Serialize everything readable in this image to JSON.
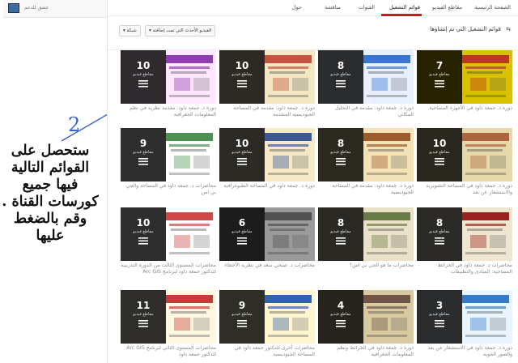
{
  "left": {
    "channel_name": "عشق للدعم",
    "annotation": "ستحصل على القوائم التالية فيها جميع كورسات القناة . وقم بالضغط عليها",
    "annotation_mark": "2"
  },
  "tabs": [
    {
      "label": "الصفحة الرئيسية",
      "active": false
    },
    {
      "label": "مقاطع الفيديو",
      "active": false
    },
    {
      "label": "قوائم التشغيل",
      "active": true
    },
    {
      "label": "القنوات",
      "active": false
    },
    {
      "label": "مناقشة",
      "active": false
    },
    {
      "label": "حول",
      "active": false
    }
  ],
  "section": {
    "title": "قوائم التشغيل التي تم إنشاؤها",
    "sort_label": "الفيديو الأحدث التي تمت إضافته",
    "share_label": "شبكة"
  },
  "overlay_label": "مقاطع فيديو",
  "cards": [
    {
      "count": "7",
      "caption": "دورة د. جمعة داود في الأجهزة المساحية",
      "colors": [
        "#d8c200",
        "#b81e1e"
      ],
      "overlay_side": "left"
    },
    {
      "count": "8",
      "caption": "دورة د. جمعة داود: مقدمة في التحليل المكاني",
      "colors": [
        "#e8f0ff",
        "#1a5fc8"
      ],
      "overlay_side": "left"
    },
    {
      "count": "10",
      "caption": "دورة د. جمعة داود: مقدمة في المساحة الجيوديسية المتقدمة",
      "colors": [
        "#f2e7c2",
        "#c0392b"
      ],
      "overlay_side": "left"
    },
    {
      "count": "10",
      "caption": "دورة د. جمعة داود: مقدمة نظرية في نظم المعلومات الجغرافية",
      "colors": [
        "#ffe8ff",
        "#7b1fa2"
      ],
      "overlay_side": "left"
    },
    {
      "count": "10",
      "caption": "دورة د. جمعة داود في المساحة التصويرية والاستشعار عن بعد",
      "colors": [
        "#e6d8a8",
        "#a0522d"
      ],
      "overlay_side": "left"
    },
    {
      "count": "8",
      "caption": "دورة د. جمعة داود: مقدمة في المساحة الجيوديسية",
      "colors": [
        "#f3e2b5",
        "#8b4513"
      ],
      "overlay_side": "left"
    },
    {
      "count": "10",
      "caption": "دورة د. جمعة داود في المساحة الطبوغرافية",
      "colors": [
        "#f5e9c8",
        "#1b3f8b"
      ],
      "overlay_side": "left"
    },
    {
      "count": "9",
      "caption": "محاضرات د. جمعة داود في المساحة والجي بي اس",
      "colors": [
        "#ffffff",
        "#2e7d32"
      ],
      "overlay_side": "left"
    },
    {
      "count": "8",
      "caption": "محاضرات د. جمعة داود في الخرائط المساحية: المبادئ والتطبيقات",
      "colors": [
        "#eee6d0",
        "#8b0000"
      ],
      "overlay_side": "left"
    },
    {
      "count": "8",
      "caption": "محاضرات ما هو الجي بي اس؟",
      "colors": [
        "#eae2c8",
        "#556b2f"
      ],
      "overlay_side": "left"
    },
    {
      "count": "6",
      "caption": "محاضرات د. صبحي سعد في نظرية الأخطاء",
      "colors": [
        "#9a9a9a",
        "#444444"
      ],
      "overlay_side": "left"
    },
    {
      "count": "10",
      "caption": "محاضرات المستوى الثالث من الدورة التدريبية للدكتور جمعة داود لبرنامج Arc GIS",
      "colors": [
        "#ffffff",
        "#c62828"
      ],
      "overlay_side": "left"
    },
    {
      "count": "3",
      "caption": "دورة د. جمعة داود في الاستشعار عن بعد والصور الجوية",
      "colors": [
        "#e8f4ff",
        "#1565c0"
      ],
      "overlay_side": "left"
    },
    {
      "count": "4",
      "caption": "دورة د. جمعة داود في الخرائط ونظم المعلومات الجغرافية",
      "colors": [
        "#d9c9a0",
        "#5d4037"
      ],
      "overlay_side": "left"
    },
    {
      "count": "9",
      "caption": "محاضرات أخرى للدكتور جمعة داود في المساحة الجيوديسية",
      "colors": [
        "#fff6d0",
        "#0d47a1"
      ],
      "overlay_side": "left"
    },
    {
      "count": "11",
      "caption": "محاضرات المستوى الثاني لبرنامج Arc GIS للدكتور جمعة داود",
      "colors": [
        "#fff8e0",
        "#b71c1c"
      ],
      "overlay_side": "left"
    }
  ]
}
